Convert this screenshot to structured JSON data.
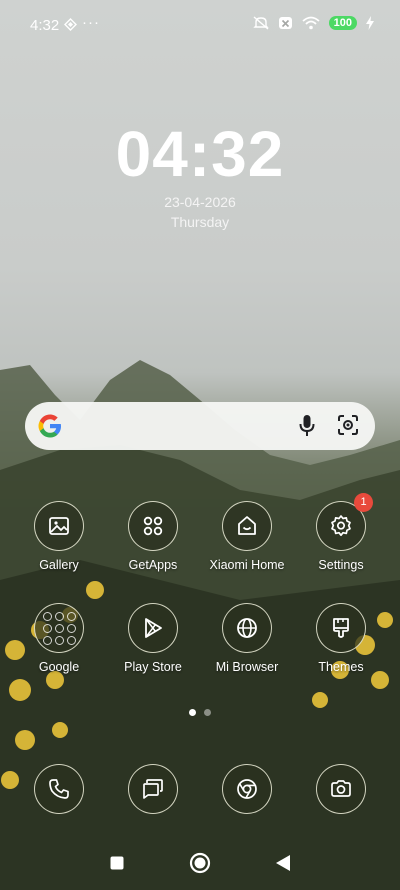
{
  "status_bar": {
    "time": "4:32",
    "more": "···",
    "battery": "100"
  },
  "clock": {
    "time": "04:32",
    "date": "23-04-2026",
    "day": "Thursday"
  },
  "search_bar": {
    "icons": [
      "google-logo",
      "mic-icon",
      "lens-icon"
    ]
  },
  "apps_row1": [
    {
      "label": "Gallery",
      "icon": "gallery-icon"
    },
    {
      "label": "GetApps",
      "icon": "getapps-icon"
    },
    {
      "label": "Xiaomi Home",
      "icon": "home-icon"
    },
    {
      "label": "Settings",
      "icon": "gear-icon",
      "badge": "1"
    }
  ],
  "apps_row2": [
    {
      "label": "Google",
      "icon": "google-folder"
    },
    {
      "label": "Play Store",
      "icon": "play-store-icon"
    },
    {
      "label": "Mi Browser",
      "icon": "globe-icon"
    },
    {
      "label": "Themes",
      "icon": "brush-icon"
    }
  ],
  "dock": [
    {
      "icon": "phone-icon"
    },
    {
      "icon": "messages-icon"
    },
    {
      "icon": "chrome-icon"
    },
    {
      "icon": "camera-icon"
    }
  ],
  "pager": {
    "pages": 2,
    "current": 1
  },
  "navigation": [
    "recents-button",
    "home-button",
    "back-button"
  ]
}
